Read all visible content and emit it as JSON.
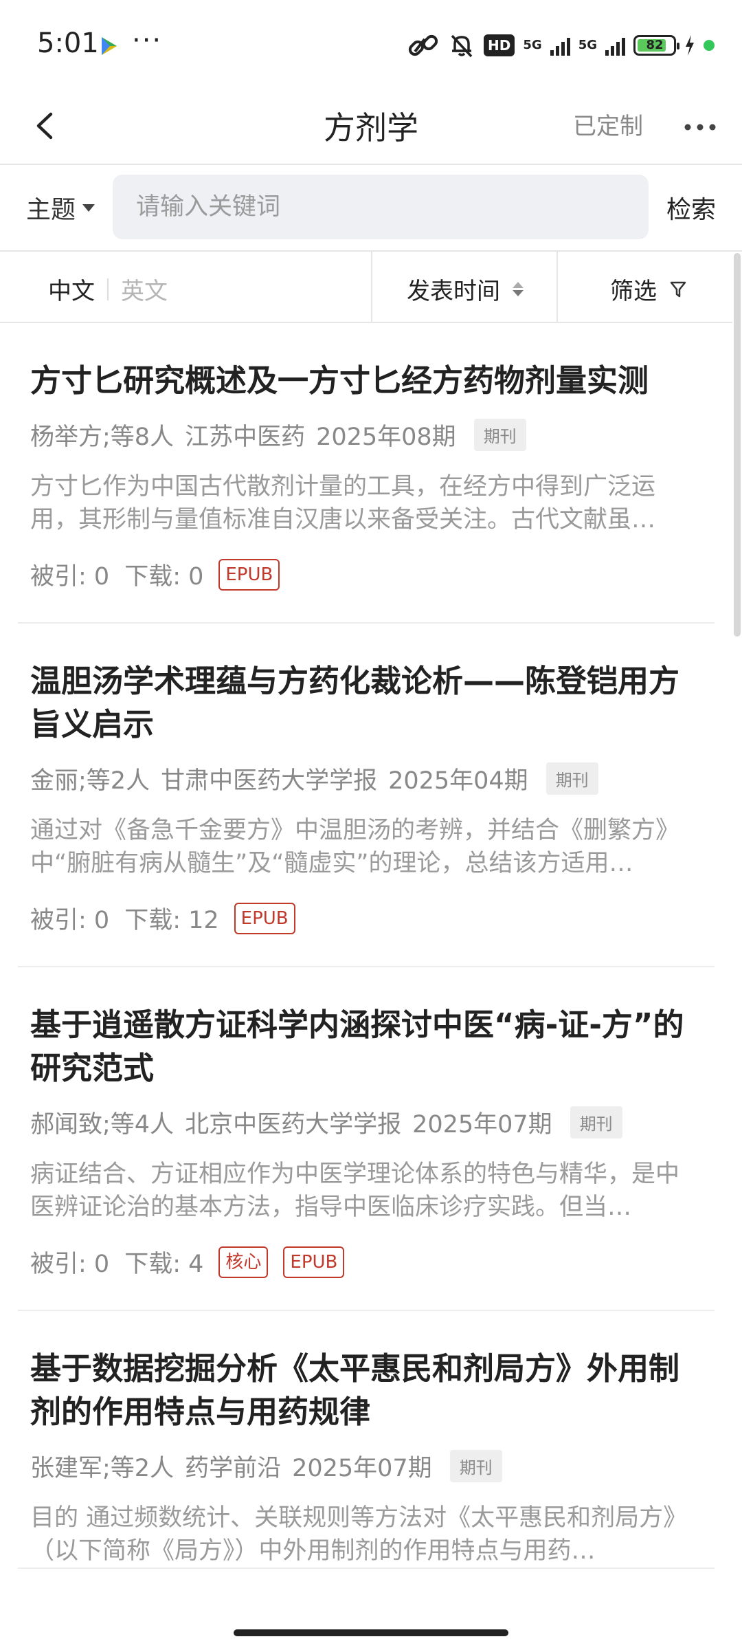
{
  "status_bar": {
    "time": "5:01",
    "network": "5G",
    "battery": 82,
    "hd_badge": "HD"
  },
  "nav": {
    "title": "方剂学",
    "customized_label": "已定制"
  },
  "search": {
    "topic_label": "主题",
    "placeholder": "请输入关键词",
    "button_label": "检索"
  },
  "filters": {
    "lang_zh": "中文",
    "lang_en": "英文",
    "sort_label": "发表时间",
    "filter_label": "筛选"
  },
  "articles": [
    {
      "title": "方寸匕研究概述及一方寸匕经方药物剂量实测",
      "authors": "杨举方;等8人",
      "journal": "江苏中医药",
      "issue": "2025年08期",
      "type": "期刊",
      "abstract": "方寸匕作为中国古代散剂计量的工具，在经方中得到广泛运用，其形制与量值标准自汉唐以来备受关注。古代文献虽…",
      "cited": "被引: 0",
      "downloads": "下载: 0",
      "badges": [
        "EPUB"
      ]
    },
    {
      "title": "温胆汤学术理蕴与方药化裁论析——陈登铠用方旨义启示",
      "authors": "金丽;等2人",
      "journal": "甘肃中医药大学学报",
      "issue": "2025年04期",
      "type": "期刊",
      "abstract": "通过对《备急千金要方》中温胆汤的考辨，并结合《删繁方》中“腑脏有病从髓生”及“髓虚实”的理论，总结该方适用…",
      "cited": "被引: 0",
      "downloads": "下载: 12",
      "badges": [
        "EPUB"
      ]
    },
    {
      "title": "基于逍遥散方证科学内涵探讨中医“病-证-方”的研究范式",
      "authors": "郝闻致;等4人",
      "journal": "北京中医药大学学报",
      "issue": "2025年07期",
      "type": "期刊",
      "abstract": "病证结合、方证相应作为中医学理论体系的特色与精华，是中医辨证论治的基本方法，指导中医临床诊疗实践。但当…",
      "cited": "被引: 0",
      "downloads": "下载: 4",
      "badges": [
        "核心",
        "EPUB"
      ]
    },
    {
      "title": "基于数据挖掘分析《太平惠民和剂局方》外用制剂的作用特点与用药规律",
      "authors": "张建军;等2人",
      "journal": "药学前沿",
      "issue": "2025年07期",
      "type": "期刊",
      "abstract": "目的 通过频数统计、关联规则等方法对《太平惠民和剂局方》（以下简称《局方》）中外用制剂的作用特点与用药…",
      "cited": "",
      "downloads": "",
      "badges": []
    }
  ]
}
